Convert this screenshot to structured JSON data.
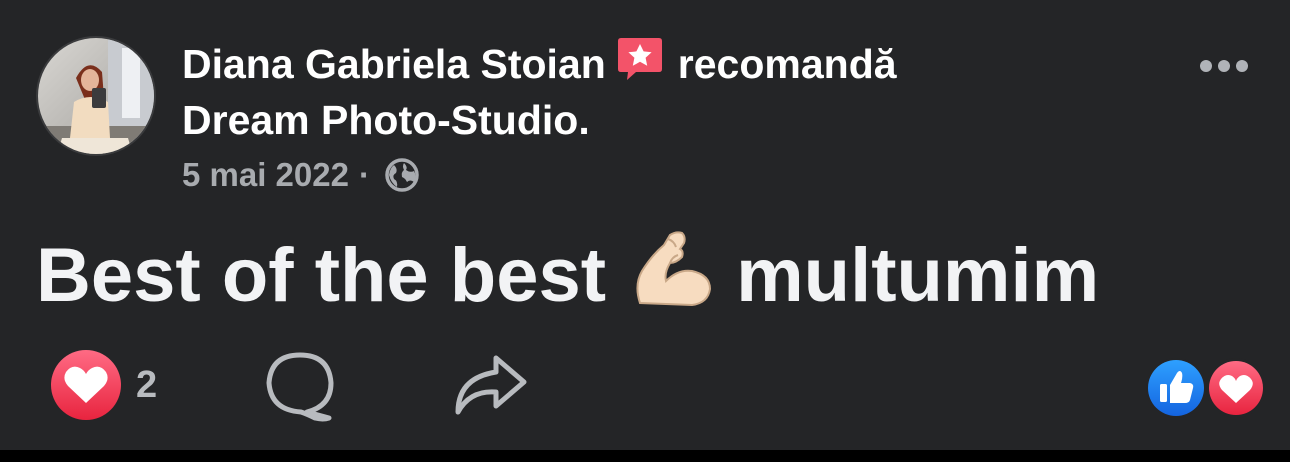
{
  "post": {
    "author_name": "Diana Gabriela Stoian",
    "action_text": "recomandă",
    "page_name": "Dream Photo-Studio.",
    "date": "5 mai 2022",
    "separator": "·",
    "audience_icon": "globe-icon",
    "text_part1": "Best of the best",
    "text_emoji": "flexed-biceps-emoji",
    "text_part2": "multumim",
    "reaction_count": "2"
  },
  "icons": {
    "recommend_badge": "recommend-star-icon",
    "more": "more-options-icon",
    "love": "love-reaction-icon",
    "like": "like-reaction-icon",
    "comment": "comment-icon",
    "share": "share-icon"
  },
  "colors": {
    "background": "#242527",
    "love_red": "#f33e58",
    "like_blue": "#1877f2",
    "badge_pink": "#f35369",
    "muted_text": "#a8abaf"
  }
}
